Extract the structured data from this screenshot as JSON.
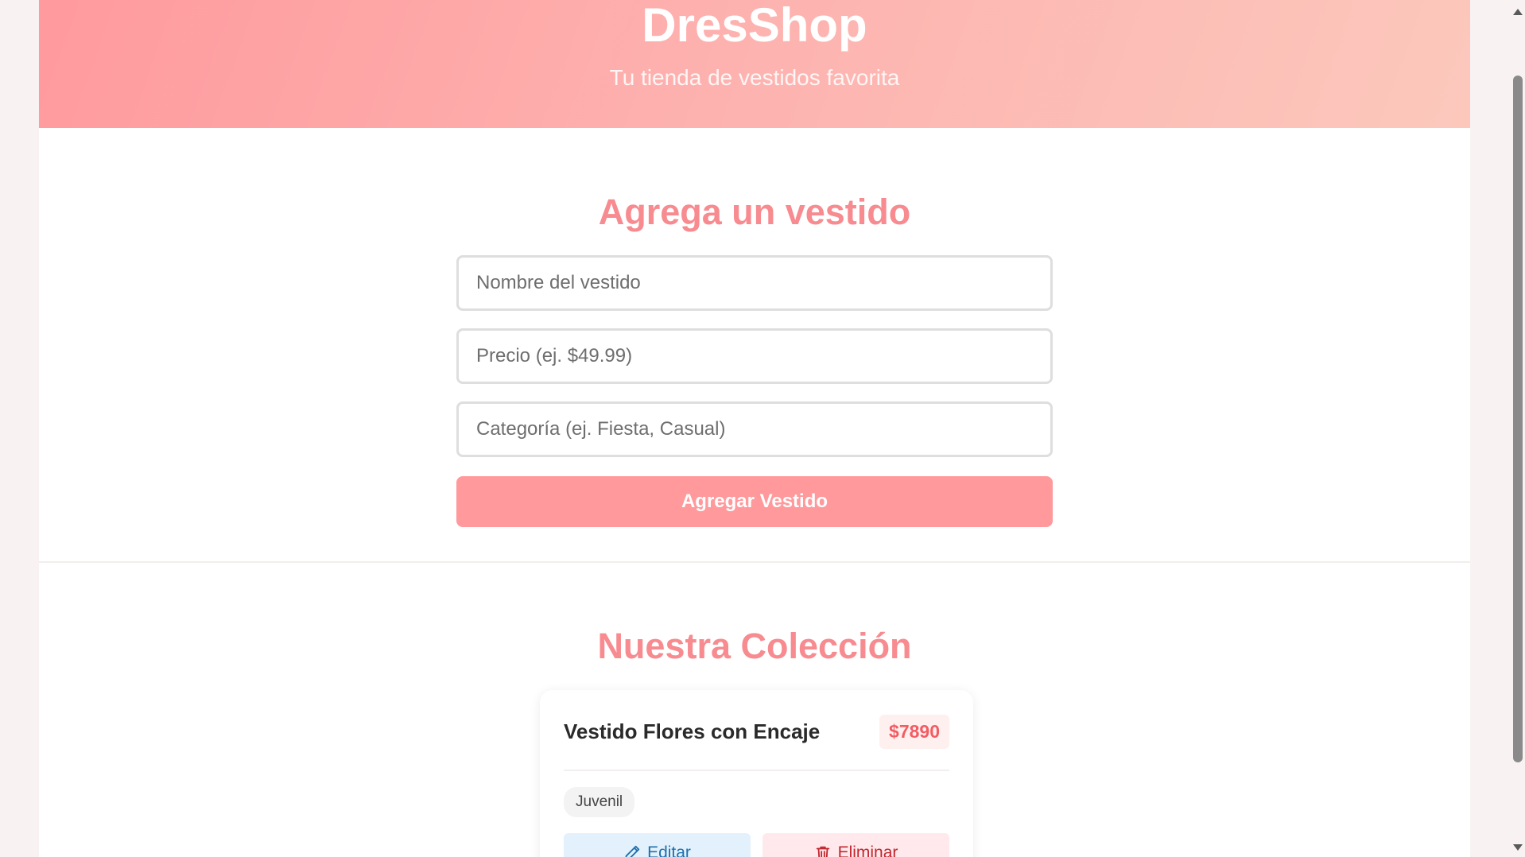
{
  "header": {
    "brand": "DresShop",
    "tagline": "Tu tienda de vestidos favorita"
  },
  "form": {
    "title": "Agrega un vestido",
    "name_placeholder": "Nombre del vestido",
    "price_placeholder": "Precio (ej. $49.99)",
    "category_placeholder": "Categoría (ej. Fiesta, Casual)",
    "submit_label": "Agregar Vestido"
  },
  "collection": {
    "title": "Nuestra Colección",
    "items": [
      {
        "name": "Vestido Flores con Encaje",
        "price": "$7890",
        "category": "Juvenil",
        "edit_label": "Editar",
        "delete_label": "Eliminar"
      }
    ]
  },
  "colors": {
    "accent": "#ff999c",
    "title": "#f78b90",
    "price": "#f15d63",
    "edit": "#1d6fae",
    "delete": "#c3262f"
  },
  "icons": {
    "edit": "pencil-icon",
    "delete": "trash-icon"
  }
}
